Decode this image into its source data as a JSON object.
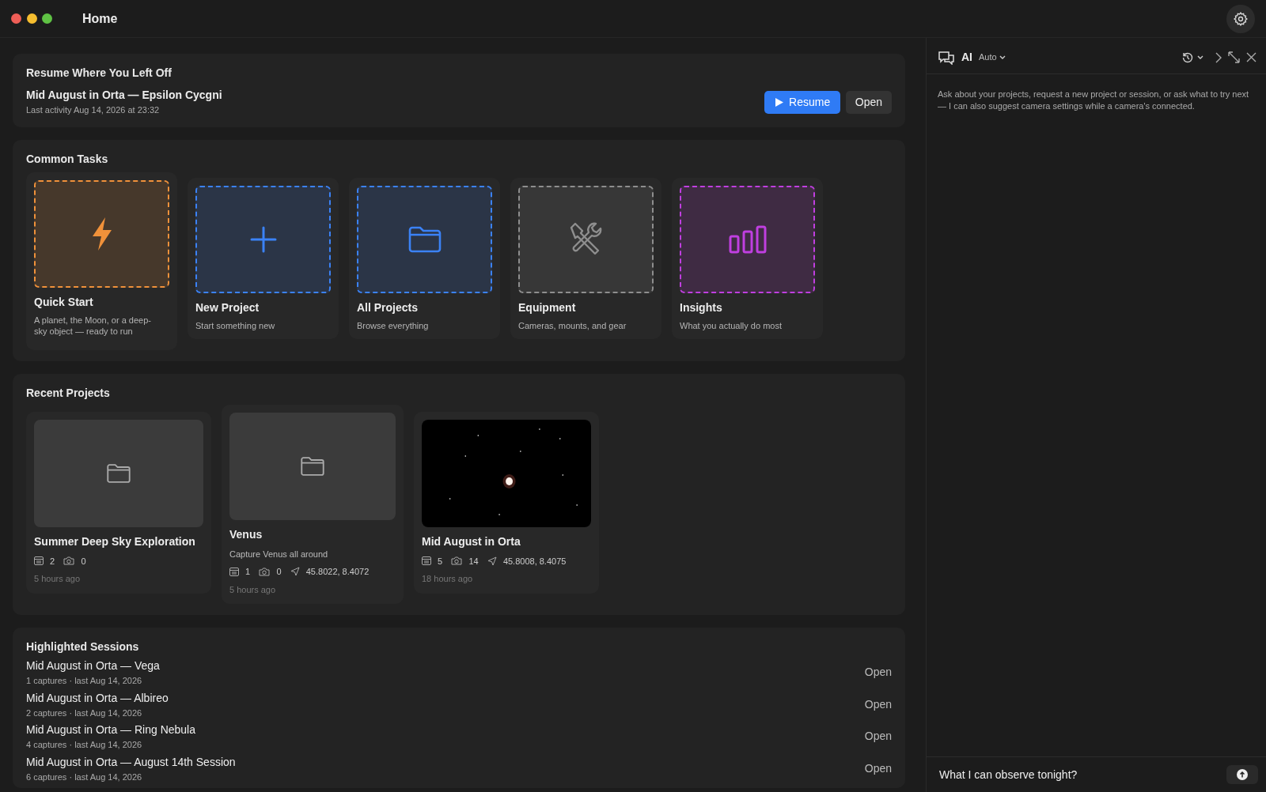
{
  "window": {
    "title": "Home"
  },
  "resume": {
    "heading": "Resume Where You Left Off",
    "title": "Mid August in Orta — Epsilon Cycgni",
    "subtitle": "Last activity Aug 14, 2026 at 23:32",
    "buttons": [
      {
        "label": "Resume",
        "kind": "primary"
      },
      {
        "label": "Open",
        "kind": "secondary"
      }
    ]
  },
  "common_tasks": {
    "heading": "Common Tasks",
    "items": [
      {
        "kind": "bolt",
        "title": "Quick Start",
        "subtitle": "A planet, the Moon, or a deep-sky object — ready to run",
        "color": "#f0913a",
        "raised": true
      },
      {
        "kind": "plus",
        "title": "New Project",
        "subtitle": "Start something new",
        "color": "#3b82f6",
        "raised": false
      },
      {
        "kind": "folder",
        "title": "All Projects",
        "subtitle": "Browse everything",
        "color": "#3b82f6",
        "raised": false
      },
      {
        "kind": "tools",
        "title": "Equipment",
        "subtitle": "Cameras, mounts, and gear",
        "color": "#8e8e8e",
        "raised": false
      },
      {
        "kind": "chart",
        "title": "Insights",
        "subtitle": "What you actually do most",
        "color": "#c03fe0",
        "raised": false
      }
    ]
  },
  "recent_projects": {
    "heading": "Recent Projects",
    "items": [
      {
        "kind": "folder",
        "title": "Summer Deep Sky Exploration",
        "raised": false,
        "meta": [
          {
            "kind": "sessions",
            "text": "2"
          },
          {
            "kind": "captures",
            "text": "0"
          }
        ],
        "time": "5 hours ago"
      },
      {
        "kind": "folder",
        "title": "Venus",
        "description": "Capture Venus all around",
        "raised": true,
        "meta": [
          {
            "kind": "sessions",
            "text": "1"
          },
          {
            "kind": "captures",
            "text": "0"
          },
          {
            "kind": "location",
            "text": "45.8022, 8.4072"
          }
        ],
        "time": "5 hours ago"
      },
      {
        "kind": "picture",
        "title": "Mid August in Orta",
        "raised": false,
        "meta": [
          {
            "kind": "sessions",
            "text": "5"
          },
          {
            "kind": "captures",
            "text": "14"
          },
          {
            "kind": "location",
            "text": "45.8008, 8.4075"
          }
        ],
        "time": "18 hours ago"
      }
    ]
  },
  "highlighted_sessions": {
    "heading": "Highlighted Sessions",
    "items": [
      {
        "title": "Mid August in Orta — Vega",
        "subtitle": "1 captures · last Aug 14, 2026",
        "action": "Open"
      },
      {
        "title": "Mid August in Orta — Albireo",
        "subtitle": "2 captures · last Aug 14, 2026",
        "action": "Open"
      },
      {
        "title": "Mid August in Orta — Ring Nebula",
        "subtitle": "4 captures · last Aug 14, 2026",
        "action": "Open"
      },
      {
        "title": "Mid August in Orta — August 14th Session",
        "subtitle": "6 captures · last Aug 14, 2026",
        "action": "Open"
      }
    ]
  },
  "ai_panel": {
    "title": "AI",
    "mode": "Auto",
    "intro": "Ask about your projects, request a new project or session, or ask what to try next — I can also suggest camera settings while a camera's connected.",
    "input_value": "What I can observe tonight?"
  }
}
